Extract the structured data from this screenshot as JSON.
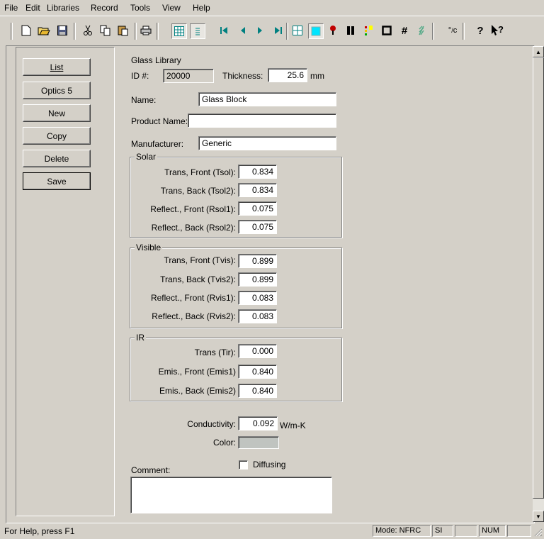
{
  "menu": [
    "File",
    "Edit",
    "Libraries",
    "Record",
    "Tools",
    "View",
    "Help"
  ],
  "toolbar": {
    "icons": [
      "new-icon",
      "open-icon",
      "save-icon",
      "cut-icon",
      "copy-icon",
      "paste-icon",
      "print-icon",
      "grid-view-icon",
      "list-view-icon",
      "first-record-icon",
      "prev-record-icon",
      "next-record-icon",
      "last-record-icon",
      "grid-icon",
      "glass-icon",
      "thermal-icon",
      "frame-icon",
      "divider-icon",
      "box-icon",
      "hash-icon",
      "hatch-icon",
      "temperature-unit-icon",
      "help-icon",
      "context-help-icon"
    ]
  },
  "side_buttons": {
    "list": "List",
    "optics": "Optics 5",
    "new": "New",
    "copy": "Copy",
    "delete": "Delete",
    "save": "Save"
  },
  "form": {
    "title": "Glass Library",
    "id_label": "ID #:",
    "id_value": "20000",
    "thickness_label": "Thickness:",
    "thickness_value": "25.6",
    "thickness_unit": "mm",
    "name_label": "Name:",
    "name_value": "Glass Block",
    "product_label": "Product Name:",
    "product_value": "",
    "manufacturer_label": "Manufacturer:",
    "manufacturer_value": "Generic"
  },
  "solar": {
    "title": "Solar",
    "rows": [
      {
        "label": "Trans, Front  (Tsol):",
        "value": "0.834"
      },
      {
        "label": "Trans, Back (Tsol2):",
        "value": "0.834"
      },
      {
        "label": "Reflect., Front (Rsol1):",
        "value": "0.075"
      },
      {
        "label": "Reflect., Back (Rsol2):",
        "value": "0.075"
      }
    ]
  },
  "visible": {
    "title": "Visible",
    "rows": [
      {
        "label": "Trans, Front (Tvis):",
        "value": "0.899"
      },
      {
        "label": "Trans, Back (Tvis2):",
        "value": "0.899"
      },
      {
        "label": "Reflect., Front (Rvis1):",
        "value": "0.083"
      },
      {
        "label": "Reflect., Back (Rvis2):",
        "value": "0.083"
      }
    ]
  },
  "ir": {
    "title": "IR",
    "rows": [
      {
        "label": "Trans (Tir):",
        "value": "0.000"
      },
      {
        "label": "Emis., Front (Emis1)",
        "value": "0.840"
      },
      {
        "label": "Emis., Back (Emis2)",
        "value": "0.840"
      }
    ]
  },
  "conductivity": {
    "label": "Conductivity:",
    "value": "0.092",
    "unit": "W/m-K"
  },
  "color": {
    "label": "Color:",
    "swatch": "#c0c4c0"
  },
  "diffusing": {
    "label": "Diffusing",
    "checked": false
  },
  "comment": {
    "label": "Comment:",
    "value": ""
  },
  "status": {
    "help": "For Help, press F1",
    "mode": "Mode: NFRC",
    "units": "SI",
    "num": "NUM"
  }
}
